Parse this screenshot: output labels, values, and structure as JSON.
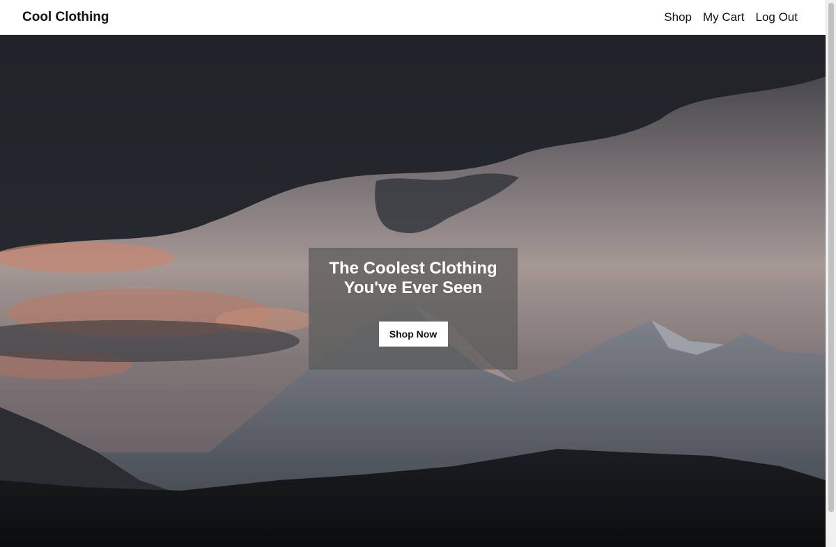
{
  "navbar": {
    "brand": "Cool Clothing",
    "links": [
      {
        "label": "Shop"
      },
      {
        "label": "My Cart"
      },
      {
        "label": "Log Out"
      }
    ]
  },
  "hero": {
    "title_line1": "The Coolest Clothing",
    "title_line2": "You've Ever Seen",
    "button_label": "Shop Now",
    "image_description_icon": "mountain-landscape-image"
  },
  "colors": {
    "navbar_bg": "#ffffff",
    "overlay_bg": "#5a5a5a",
    "button_bg": "#ffffff",
    "text_dark": "#111111",
    "text_light": "#ffffff"
  }
}
